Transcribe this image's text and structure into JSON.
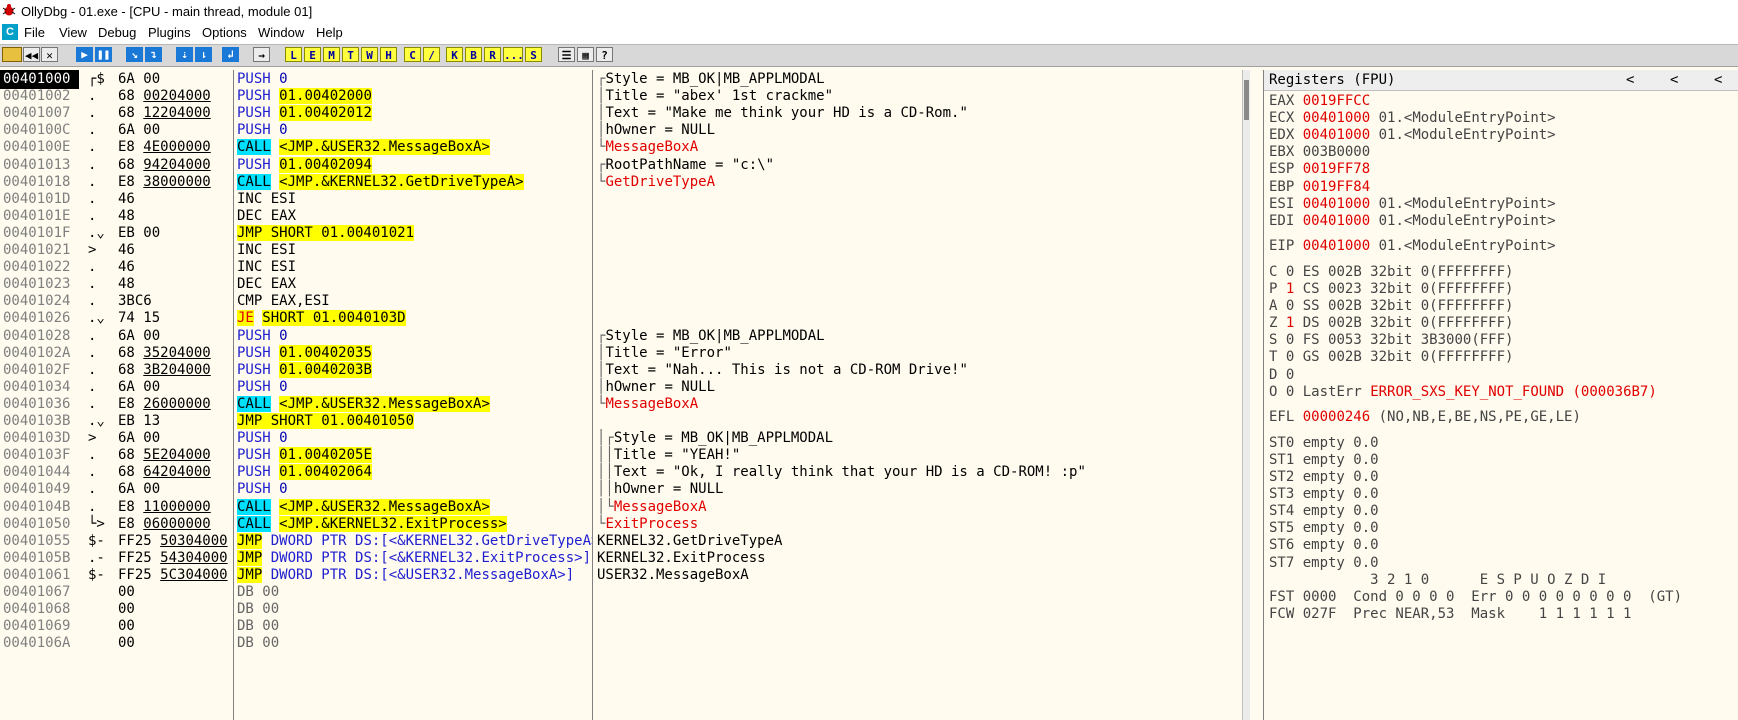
{
  "window": {
    "title": "OllyDbg - 01.exe - [CPU - main thread, module 01]"
  },
  "menu": [
    "File",
    "View",
    "Debug",
    "Plugins",
    "Options",
    "Window",
    "Help"
  ],
  "menu_icon": "C",
  "toolbar_letters": [
    "L",
    "E",
    "M",
    "T",
    "W",
    "H",
    "C",
    "/",
    "K",
    "B",
    "R",
    "...",
    "S"
  ],
  "disasm": [
    {
      "addr": "00401000",
      "mark": "┌$",
      "hex": "6A 00",
      "asm": "PUSH 0",
      "cmt": "┌Style = MB_OK|MB_APPLMODAL",
      "current": true
    },
    {
      "addr": "00401002",
      "mark": ".",
      "hex": "68 00204000",
      "asm": "PUSH 01.00402000",
      "cmt": "│Title = \"abex' 1st crackme\""
    },
    {
      "addr": "00401007",
      "mark": ".",
      "hex": "68 12204000",
      "asm": "PUSH 01.00402012",
      "cmt": "│Text = \"Make me think your HD is a CD-Rom.\""
    },
    {
      "addr": "0040100C",
      "mark": ".",
      "hex": "6A 00",
      "asm": "PUSH 0",
      "cmt": "│hOwner = NULL"
    },
    {
      "addr": "0040100E",
      "mark": ".",
      "hex": "E8 4E000000",
      "asm": "CALL <JMP.&USER32.MessageBoxA>",
      "cmt": "└MessageBoxA"
    },
    {
      "addr": "00401013",
      "mark": ".",
      "hex": "68 94204000",
      "asm": "PUSH 01.00402094",
      "cmt": "┌RootPathName = \"c:\\\""
    },
    {
      "addr": "00401018",
      "mark": ".",
      "hex": "E8 38000000",
      "asm": "CALL <JMP.&KERNEL32.GetDriveTypeA>",
      "cmt": "└GetDriveTypeA"
    },
    {
      "addr": "0040101D",
      "mark": ".",
      "hex": "46",
      "asm": "INC ESI",
      "cmt": ""
    },
    {
      "addr": "0040101E",
      "mark": ".",
      "hex": "48",
      "asm": "DEC EAX",
      "cmt": ""
    },
    {
      "addr": "0040101F",
      "mark": ".⌄",
      "hex": "EB 00",
      "asm": "JMP SHORT 01.00401021",
      "cmt": ""
    },
    {
      "addr": "00401021",
      "mark": ">",
      "hex": "46",
      "asm": "INC ESI",
      "cmt": ""
    },
    {
      "addr": "00401022",
      "mark": ".",
      "hex": "46",
      "asm": "INC ESI",
      "cmt": ""
    },
    {
      "addr": "00401023",
      "mark": ".",
      "hex": "48",
      "asm": "DEC EAX",
      "cmt": ""
    },
    {
      "addr": "00401024",
      "mark": ".",
      "hex": "3BC6",
      "asm": "CMP EAX,ESI",
      "cmt": ""
    },
    {
      "addr": "00401026",
      "mark": ".⌄",
      "hex": "74 15",
      "asm": "JE SHORT 01.0040103D",
      "cmt": ""
    },
    {
      "addr": "00401028",
      "mark": ".",
      "hex": "6A 00",
      "asm": "PUSH 0",
      "cmt": "┌Style = MB_OK|MB_APPLMODAL"
    },
    {
      "addr": "0040102A",
      "mark": ".",
      "hex": "68 35204000",
      "asm": "PUSH 01.00402035",
      "cmt": "│Title = \"Error\""
    },
    {
      "addr": "0040102F",
      "mark": ".",
      "hex": "68 3B204000",
      "asm": "PUSH 01.0040203B",
      "cmt": "│Text = \"Nah... This is not a CD-ROM Drive!\""
    },
    {
      "addr": "00401034",
      "mark": ".",
      "hex": "6A 00",
      "asm": "PUSH 0",
      "cmt": "│hOwner = NULL"
    },
    {
      "addr": "00401036",
      "mark": ".",
      "hex": "E8 26000000",
      "asm": "CALL <JMP.&USER32.MessageBoxA>",
      "cmt": "└MessageBoxA"
    },
    {
      "addr": "0040103B",
      "mark": ".⌄",
      "hex": "EB 13",
      "asm": "JMP SHORT 01.00401050",
      "cmt": ""
    },
    {
      "addr": "0040103D",
      "mark": ">",
      "hex": "6A 00",
      "asm": "PUSH 0",
      "cmt": "│┌Style = MB_OK|MB_APPLMODAL"
    },
    {
      "addr": "0040103F",
      "mark": ".",
      "hex": "68 5E204000",
      "asm": "PUSH 01.0040205E",
      "cmt": "││Title = \"YEAH!\""
    },
    {
      "addr": "00401044",
      "mark": ".",
      "hex": "68 64204000",
      "asm": "PUSH 01.00402064",
      "cmt": "││Text = \"Ok, I really think that your HD is a CD-ROM! :p\""
    },
    {
      "addr": "00401049",
      "mark": ".",
      "hex": "6A 00",
      "asm": "PUSH 0",
      "cmt": "││hOwner = NULL"
    },
    {
      "addr": "0040104B",
      "mark": ".",
      "hex": "E8 11000000",
      "asm": "CALL <JMP.&USER32.MessageBoxA>",
      "cmt": "│└MessageBoxA"
    },
    {
      "addr": "00401050",
      "mark": "└>",
      "hex": "E8 06000000",
      "asm": "CALL <JMP.&KERNEL32.ExitProcess>",
      "cmt": "└ExitProcess"
    },
    {
      "addr": "00401055",
      "mark": "$-",
      "hex": "FF25 50304000",
      "asm": "JMP DWORD PTR DS:[<&KERNEL32.GetDriveTypeA>]",
      "cmt": "KERNEL32.GetDriveTypeA"
    },
    {
      "addr": "0040105B",
      "mark": ".-",
      "hex": "FF25 54304000",
      "asm": "JMP DWORD PTR DS:[<&KERNEL32.ExitProcess>]",
      "cmt": "KERNEL32.ExitProcess"
    },
    {
      "addr": "00401061",
      "mark": "$-",
      "hex": "FF25 5C304000",
      "asm": "JMP DWORD PTR DS:[<&USER32.MessageBoxA>]",
      "cmt": "USER32.MessageBoxA"
    },
    {
      "addr": "00401067",
      "mark": "",
      "hex": "00",
      "asm": "DB 00",
      "cmt": ""
    },
    {
      "addr": "00401068",
      "mark": "",
      "hex": "00",
      "asm": "DB 00",
      "cmt": ""
    },
    {
      "addr": "00401069",
      "mark": "",
      "hex": "00",
      "asm": "DB 00",
      "cmt": ""
    },
    {
      "addr": "0040106A",
      "mark": "",
      "hex": "00",
      "asm": "DB 00",
      "cmt": ""
    }
  ],
  "registers": {
    "header": "Registers (FPU)",
    "nav": [
      "<",
      "<",
      "<"
    ],
    "gp": [
      {
        "name": "EAX",
        "value": "0019FFCC",
        "desc": "",
        "changed": true
      },
      {
        "name": "ECX",
        "value": "00401000",
        "desc": "01.<ModuleEntryPoint>",
        "changed": true
      },
      {
        "name": "EDX",
        "value": "00401000",
        "desc": "01.<ModuleEntryPoint>",
        "changed": true
      },
      {
        "name": "EBX",
        "value": "003B0000",
        "desc": "",
        "changed": false
      },
      {
        "name": "ESP",
        "value": "0019FF78",
        "desc": "",
        "changed": true
      },
      {
        "name": "EBP",
        "value": "0019FF84",
        "desc": "",
        "changed": true
      },
      {
        "name": "ESI",
        "value": "00401000",
        "desc": "01.<ModuleEntryPoint>",
        "changed": true
      },
      {
        "name": "EDI",
        "value": "00401000",
        "desc": "01.<ModuleEntryPoint>",
        "changed": true
      }
    ],
    "eip": {
      "name": "EIP",
      "value": "00401000",
      "desc": "01.<ModuleEntryPoint>"
    },
    "flags": [
      {
        "flag": "C",
        "val": "0",
        "changed": false,
        "seg": "ES 002B 32bit 0(FFFFFFFF)"
      },
      {
        "flag": "P",
        "val": "1",
        "changed": true,
        "seg": "CS 0023 32bit 0(FFFFFFFF)"
      },
      {
        "flag": "A",
        "val": "0",
        "changed": false,
        "seg": "SS 002B 32bit 0(FFFFFFFF)"
      },
      {
        "flag": "Z",
        "val": "1",
        "changed": true,
        "seg": "DS 002B 32bit 0(FFFFFFFF)"
      },
      {
        "flag": "S",
        "val": "0",
        "changed": false,
        "seg": "FS 0053 32bit 3B3000(FFF)"
      },
      {
        "flag": "T",
        "val": "0",
        "changed": false,
        "seg": "GS 002B 32bit 0(FFFFFFFF)"
      },
      {
        "flag": "D",
        "val": "0",
        "changed": false,
        "seg": ""
      }
    ],
    "lasterr": {
      "flag": "O",
      "val": "0",
      "label": "LastErr",
      "value": "ERROR_SXS_KEY_NOT_FOUND (000036B7)"
    },
    "efl": {
      "name": "EFL",
      "value": "00000246",
      "desc": "(NO,NB,E,BE,NS,PE,GE,LE)"
    },
    "fpu": [
      "ST0 empty 0.0",
      "ST1 empty 0.0",
      "ST2 empty 0.0",
      "ST3 empty 0.0",
      "ST4 empty 0.0",
      "ST5 empty 0.0",
      "ST6 empty 0.0",
      "ST7 empty 0.0"
    ],
    "fst_header": "            3 2 1 0      E S P U O Z D I",
    "fst": "FST 0000  Cond 0 0 0 0  Err 0 0 0 0 0 0 0 0  (GT)",
    "fcw": "FCW 027F  Prec NEAR,53  Mask    1 1 1 1 1 1"
  }
}
